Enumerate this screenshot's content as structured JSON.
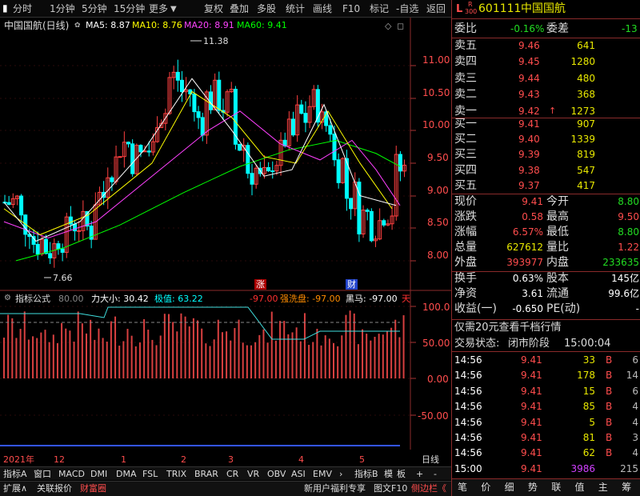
{
  "toolbar": {
    "left_tabs": [
      "分时",
      "1分钟",
      "5分钟",
      "15分钟",
      "更多"
    ],
    "right_tabs": [
      "复权",
      "叠加",
      "多股",
      "统计",
      "画线",
      "F10",
      "标记",
      "-自选",
      "返回"
    ]
  },
  "chart": {
    "title": "中国国航(日线)",
    "ma5": "MA5: 8.87",
    "ma10": "MA10: 8.76",
    "ma20": "MA20: 8.91",
    "ma60": "MA60: 9.41",
    "high_marker": "11.38",
    "low_marker": "7.66",
    "axis_labels": [
      "11.00",
      "10.50",
      "10.00",
      "9.50",
      "9.00",
      "8.50",
      "8.00"
    ],
    "tag_up": "涨",
    "tag_fin": "财",
    "colors": {
      "ma5": "#ffffff",
      "ma10": "#ffff00",
      "ma20": "#ff40ff",
      "ma60": "#00ff00",
      "up": "#ff4040",
      "down": "#00ffff"
    }
  },
  "indicator": {
    "name": "指标公式",
    "v80": "80.00",
    "size_label": "力大小: 30.42",
    "ext_label": "极值: 63.22",
    "v97": "-97.00",
    "wash_label": "强洗盘: -97.00",
    "black_horse": "黑马: -97.00",
    "sky": "天",
    "axis_labels": [
      "100.0",
      "50.00",
      "0.00",
      "-50.00"
    ]
  },
  "dates": {
    "year": "2021年",
    "months": [
      "12",
      "1",
      "2",
      "3",
      "4",
      "5"
    ],
    "right": "日线"
  },
  "tabs": [
    "指标A",
    "窗口",
    "MACD",
    "DMI",
    "DMA",
    "FSL",
    "TRIX",
    "BRAR",
    "CR",
    "VR",
    "OBV",
    "ASI",
    "EMV"
  ],
  "tabs_right": [
    "指标B",
    "模",
    "板",
    "+",
    "-"
  ],
  "bottom_bar": {
    "left": [
      "扩展∧",
      "关联报价",
      "财富圈"
    ],
    "mid": "新用户福利专享",
    "right": [
      "图文F10",
      "侧边栏《"
    ],
    "side": [
      "笔",
      "价",
      "细",
      "势",
      "联",
      "值",
      "主",
      "筹"
    ]
  },
  "stock": {
    "flag_l": "L",
    "flag_r": "R",
    "flag_n": "300",
    "code": "601111",
    "name": "中国国航",
    "weibi_label": "委比",
    "weibi": "-0.16%",
    "weicha_label": "委差",
    "weicha": "-13",
    "asks": [
      {
        "label": "卖五",
        "price": "9.46",
        "vol": "641",
        "arrow": ""
      },
      {
        "label": "卖四",
        "price": "9.45",
        "vol": "1280",
        "arrow": ""
      },
      {
        "label": "卖三",
        "price": "9.44",
        "vol": "480",
        "arrow": ""
      },
      {
        "label": "卖二",
        "price": "9.43",
        "vol": "368",
        "arrow": ""
      },
      {
        "label": "卖一",
        "price": "9.42",
        "vol": "1273",
        "arrow": "↑"
      }
    ],
    "bids": [
      {
        "label": "买一",
        "price": "9.41",
        "vol": "907"
      },
      {
        "label": "买二",
        "price": "9.40",
        "vol": "1339"
      },
      {
        "label": "买三",
        "price": "9.39",
        "vol": "819"
      },
      {
        "label": "买四",
        "price": "9.38",
        "vol": "547"
      },
      {
        "label": "买五",
        "price": "9.37",
        "vol": "417"
      }
    ],
    "quote": [
      {
        "l1": "现价",
        "v1": "9.41",
        "c1": "red",
        "l2": "今开",
        "v2": "8.80",
        "c2": "grn"
      },
      {
        "l1": "涨跌",
        "v1": "0.58",
        "c1": "red",
        "l2": "最高",
        "v2": "9.50",
        "c2": "red"
      },
      {
        "l1": "涨幅",
        "v1": "6.57%",
        "c1": "red",
        "l2": "最低",
        "v2": "8.80",
        "c2": "grn"
      },
      {
        "l1": "总量",
        "v1": "627612",
        "c1": "yel",
        "l2": "量比",
        "v2": "1.22",
        "c2": "red"
      },
      {
        "l1": "外盘",
        "v1": "393977",
        "c1": "red",
        "l2": "内盘",
        "v2": "233635",
        "c2": "grn"
      }
    ],
    "quote2": [
      {
        "l1": "换手",
        "v1": "0.63%",
        "l2": "股本",
        "v2": "145亿"
      },
      {
        "l1": "净资",
        "v1": "3.61",
        "l2": "流通",
        "v2": "99.6亿"
      },
      {
        "l1": "收益(一)",
        "v1": "-0.650",
        "l2": "PE(动)",
        "v2": "-"
      }
    ],
    "promo": "仅需20元查看千档行情",
    "status_label": "交易状态:",
    "status": "闭市阶段",
    "status_time": "15:00:04",
    "ticks": [
      {
        "time": "14:56",
        "price": "9.41",
        "vol": "33",
        "side": "B",
        "n": "6"
      },
      {
        "time": "14:56",
        "price": "9.41",
        "vol": "178",
        "side": "B",
        "n": "14"
      },
      {
        "time": "14:56",
        "price": "9.41",
        "vol": "15",
        "side": "B",
        "n": "6"
      },
      {
        "time": "14:56",
        "price": "9.41",
        "vol": "85",
        "side": "B",
        "n": "4"
      },
      {
        "time": "14:56",
        "price": "9.41",
        "vol": "5",
        "side": "B",
        "n": "4"
      },
      {
        "time": "14:56",
        "price": "9.41",
        "vol": "81",
        "side": "B",
        "n": "3"
      },
      {
        "time": "14:56",
        "price": "9.41",
        "vol": "62",
        "side": "B",
        "n": "4"
      },
      {
        "time": "15:00",
        "price": "9.41",
        "vol": "3986",
        "side": "",
        "n": "215"
      }
    ]
  }
}
